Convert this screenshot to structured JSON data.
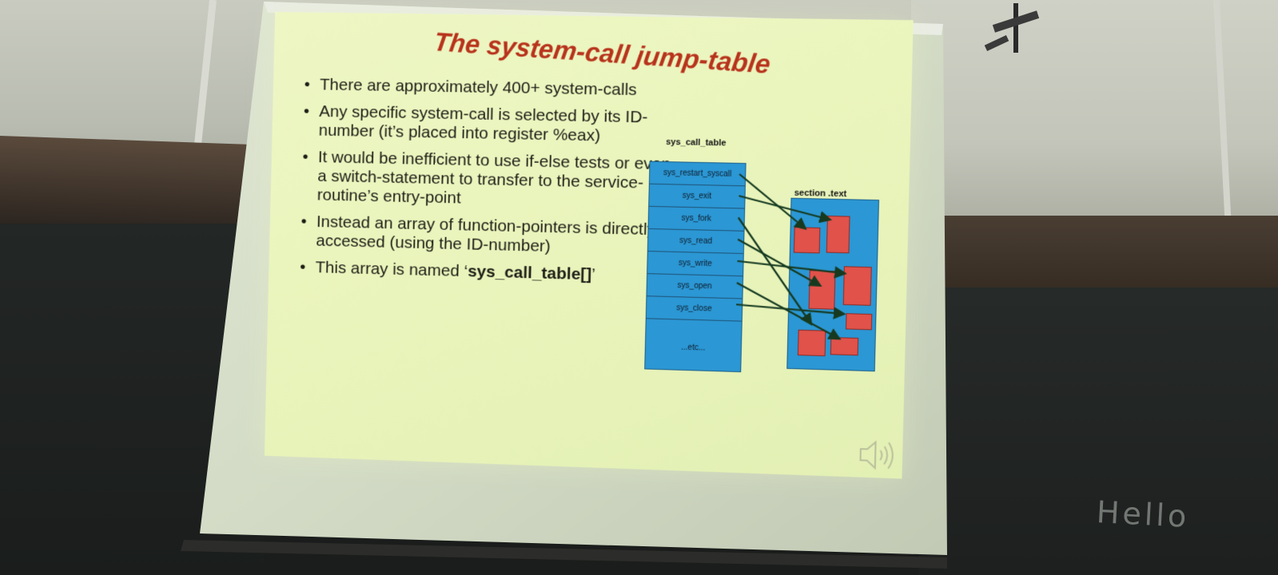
{
  "slide": {
    "title": "The system-call jump-table",
    "bullets": [
      {
        "text": "There are approximately 400+ system-calls"
      },
      {
        "text": "Any specific system-call is selected by its ID-number (it’s placed into register %eax)"
      },
      {
        "text": "It would be inefficient to use if-else tests or even a switch-statement to transfer to the service-routine’s entry-point"
      },
      {
        "text": "Instead an array of function-pointers is directly accessed (using the ID-number)"
      },
      {
        "prefix": "This array is named ‘",
        "strong": "sys_call_table[]",
        "suffix": "’"
      }
    ],
    "diagram": {
      "table_caption": "sys_call_table",
      "rows": [
        "sys_restart_syscall",
        "sys_exit",
        "sys_fork",
        "sys_read",
        "sys_write",
        "sys_open",
        "sys_close",
        "...etc..."
      ],
      "section_caption": "section .text"
    },
    "speaker_icon": "speaker-icon"
  },
  "room": {
    "board_writing": "Hello"
  },
  "colors": {
    "slide_background": "#eaf5bd",
    "title": "#b8331c",
    "table_fill": "#2b97d4",
    "routine_fill": "#e0524a"
  }
}
